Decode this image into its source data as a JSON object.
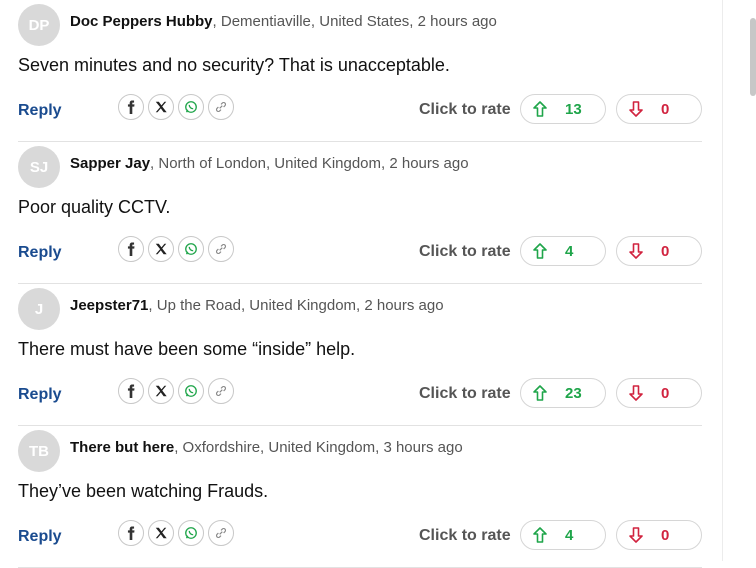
{
  "comments": [
    {
      "initials": "DP",
      "author": "Doc Peppers Hubby",
      "location_time": ", Dementiaville, United States, 2 hours ago",
      "text": "Seven minutes and no security? That is unacceptable.",
      "up": "13",
      "down": "0"
    },
    {
      "initials": "SJ",
      "author": "Sapper Jay",
      "location_time": ", North of London, United Kingdom, 2 hours ago",
      "text": "Poor quality CCTV.",
      "up": "4",
      "down": "0"
    },
    {
      "initials": "J",
      "author": "Jeepster71",
      "location_time": ", Up the Road, United Kingdom, 2 hours ago",
      "text": "There must have been some “inside” help.",
      "up": "23",
      "down": "0"
    },
    {
      "initials": "TB",
      "author": "There but here",
      "location_time": ", Oxfordshire, United Kingdom, 3 hours ago",
      "text": "They’ve been watching Frauds.",
      "up": "4",
      "down": "0"
    }
  ],
  "labels": {
    "reply": "Reply",
    "rate": "Click to rate"
  },
  "share_icons": [
    "facebook-icon",
    "x-icon",
    "whatsapp-icon",
    "link-icon"
  ],
  "colors": {
    "up": "#1fa54a",
    "down": "#d1233f",
    "link": "#1a4b8f",
    "avatar": "#d9d9d9"
  }
}
